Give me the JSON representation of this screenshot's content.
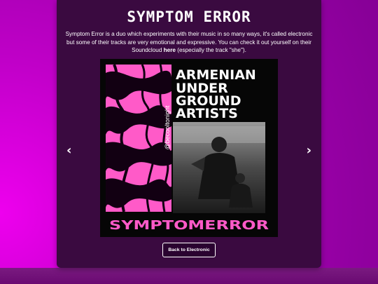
{
  "page": {
    "title": "SYMPTOM ERROR",
    "description": {
      "before_link": "Symptom Error is a duo which experiments with their music in so many ways, it's called electronic but some of their tracks are very emotional and expressive. You can check it out yourself on their Soundcloud ",
      "link_text": "here",
      "after_link": " (especially the track \"she\")."
    },
    "back_button": "Back to Electronic"
  },
  "carousel": {
    "prev_icon": "‹",
    "next_icon": "›",
    "slide": {
      "headline_lines": [
        "ARMENIAN",
        "UNDER",
        "GROUND",
        "ARTISTS"
      ],
      "side_handle": "@becooltonight",
      "footer": "SYMPTOMERROR"
    }
  },
  "colors": {
    "accent_pink": "#ff5ac8",
    "card_bg": "#3a0a40",
    "page_magenta": "#c000c8"
  }
}
